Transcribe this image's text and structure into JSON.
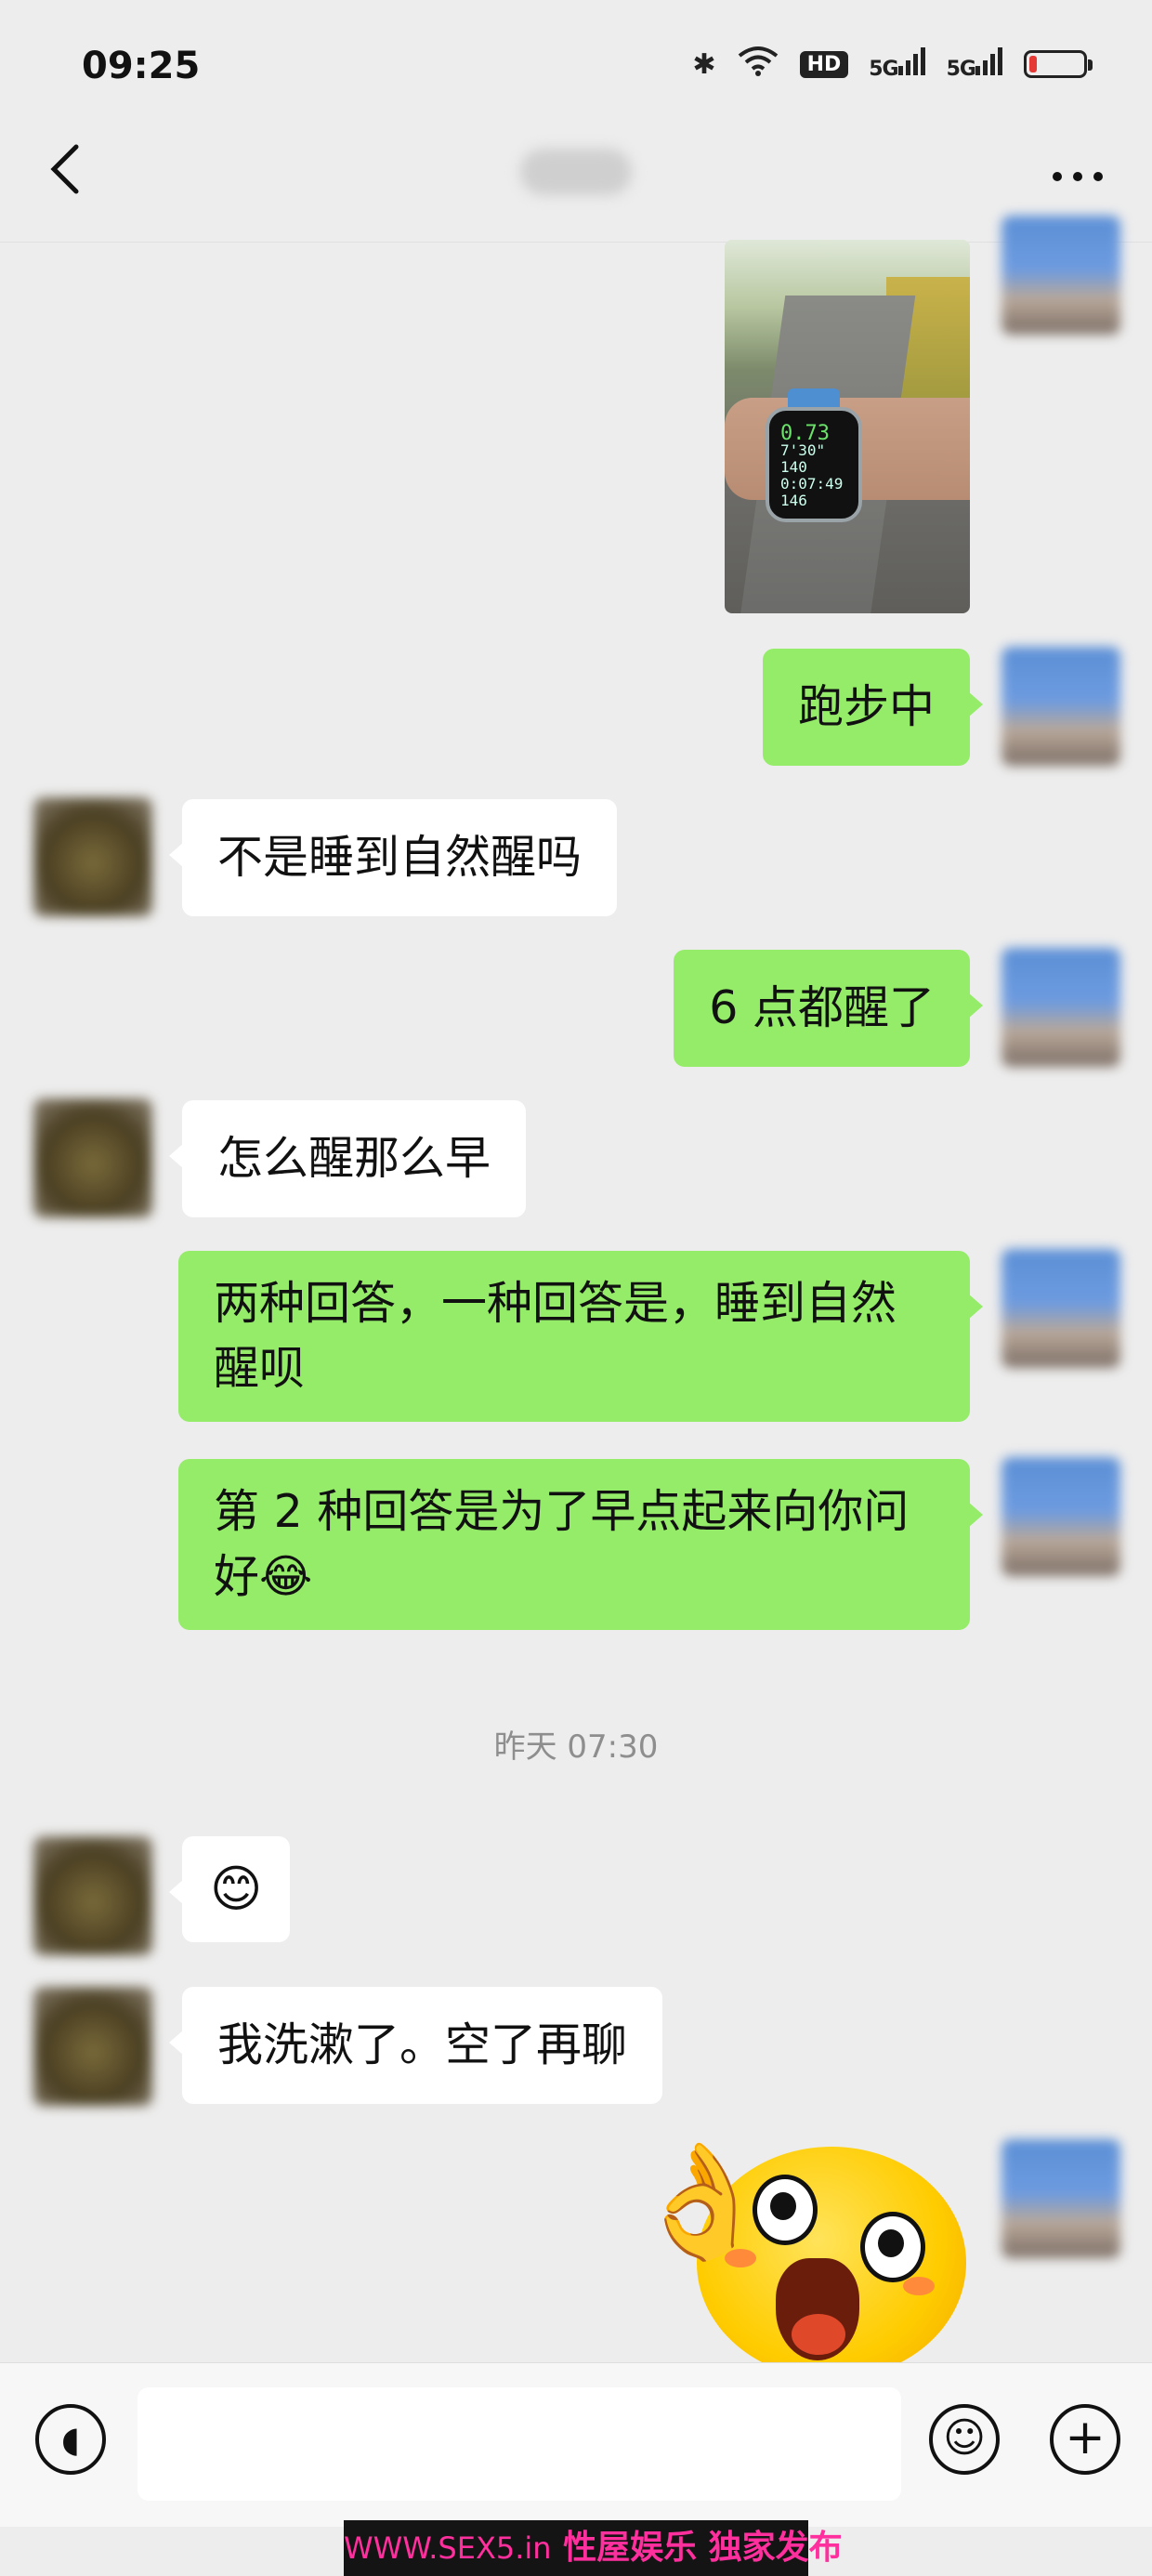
{
  "status_bar": {
    "time": "09:25",
    "icons": [
      "bluetooth-icon",
      "wifi-icon",
      "hd-icon",
      "signal-5g-icon",
      "signal-5g-icon",
      "battery-icon"
    ],
    "hd_label": "HD",
    "sig1": "5G",
    "sig2": "5G",
    "battery_level": 0.15,
    "battery_color": "#e53935"
  },
  "header": {
    "back_icon": "chevron-left-icon",
    "more_icon": "more-horizontal-icon"
  },
  "messages": [
    {
      "side": "me",
      "type": "image",
      "description_icon": "photo-icon"
    },
    {
      "side": "me",
      "type": "text",
      "text": "跑步中"
    },
    {
      "side": "other",
      "type": "text",
      "text": "不是睡到自然醒吗"
    },
    {
      "side": "me",
      "type": "text",
      "text": "6 点都醒了"
    },
    {
      "side": "other",
      "type": "text",
      "text": "怎么醒那么早"
    },
    {
      "side": "me",
      "type": "text",
      "text": "两种回答，一种回答是，睡到自然醒呗"
    },
    {
      "side": "me",
      "type": "text",
      "text": "第 2 种回答是为了早点起来向你问好😂"
    },
    {
      "side": "other",
      "type": "text",
      "text": "😊"
    },
    {
      "side": "other",
      "type": "text",
      "text": "我洗漱了。空了再聊"
    },
    {
      "side": "me",
      "type": "sticker",
      "description_icon": "ok-emoji-sticker"
    }
  ],
  "photo_watch_text": [
    "0.73",
    "7'30\"",
    "140",
    "0:07:49",
    "146"
  ],
  "timestamp": "昨天 07:30",
  "input_bar": {
    "voice_icon": "voice-icon",
    "emoji_icon": "emoji-icon",
    "plus_icon": "plus-icon",
    "placeholder": ""
  },
  "watermark": {
    "url": "WWW.SEX5.in",
    "text": "性屋娱乐 独家发布"
  },
  "colors": {
    "background": "#ededed",
    "my_bubble": "#95ec69",
    "their_bubble": "#ffffff",
    "watermark_text": "#ff2f9e"
  }
}
